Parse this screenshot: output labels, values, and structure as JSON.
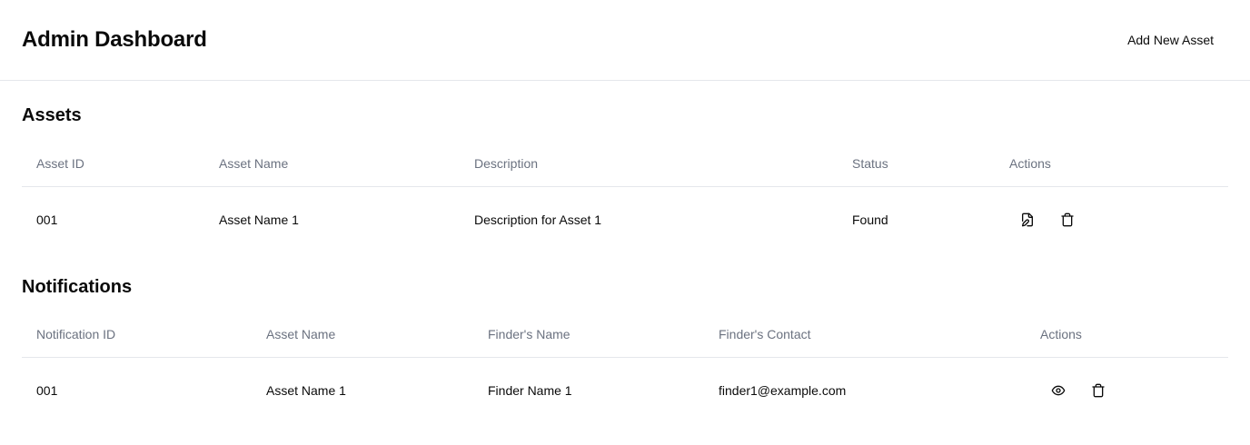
{
  "header": {
    "title": "Admin Dashboard",
    "add_button_label": "Add New Asset"
  },
  "assets": {
    "title": "Assets",
    "columns": [
      "Asset ID",
      "Asset Name",
      "Description",
      "Status",
      "Actions"
    ],
    "rows": [
      {
        "id": "001",
        "name": "Asset Name 1",
        "description": "Description for Asset 1",
        "status": "Found",
        "actions": [
          "edit-icon",
          "trash-icon"
        ]
      }
    ]
  },
  "notifications": {
    "title": "Notifications",
    "columns": [
      "Notification ID",
      "Asset Name",
      "Finder's Name",
      "Finder's Contact",
      "Actions"
    ],
    "rows": [
      {
        "id": "001",
        "asset_name": "Asset Name 1",
        "finder_name": "Finder Name 1",
        "finder_contact": "finder1@example.com",
        "actions": [
          "eye-icon",
          "trash-icon"
        ]
      }
    ]
  }
}
